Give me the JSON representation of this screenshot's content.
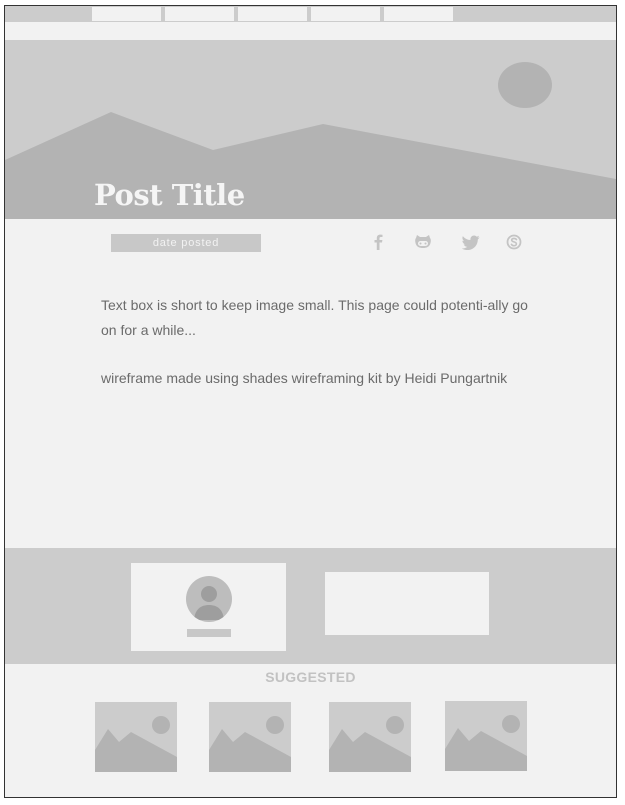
{
  "nav": {
    "tabs": [
      "",
      "",
      "",
      "",
      ""
    ]
  },
  "hero": {
    "title": "Post Title"
  },
  "meta": {
    "date": "date posted",
    "social": [
      "facebook-icon",
      "github-icon",
      "twitter-icon",
      "skype-icon"
    ]
  },
  "body": {
    "paragraph1": "Text box is short to keep image small. This page could potenti-ally go on for a while...",
    "paragraph2": "wireframe made using shades wireframing kit by Heidi Pungartnik"
  },
  "suggested": {
    "heading": "SUGGESTED",
    "count": 4
  },
  "colors": {
    "background": "#f2f2f2",
    "placeholder": "#cccccc",
    "shade": "#b3b3b3",
    "text": "#6b6b6b",
    "border": "#333333"
  }
}
